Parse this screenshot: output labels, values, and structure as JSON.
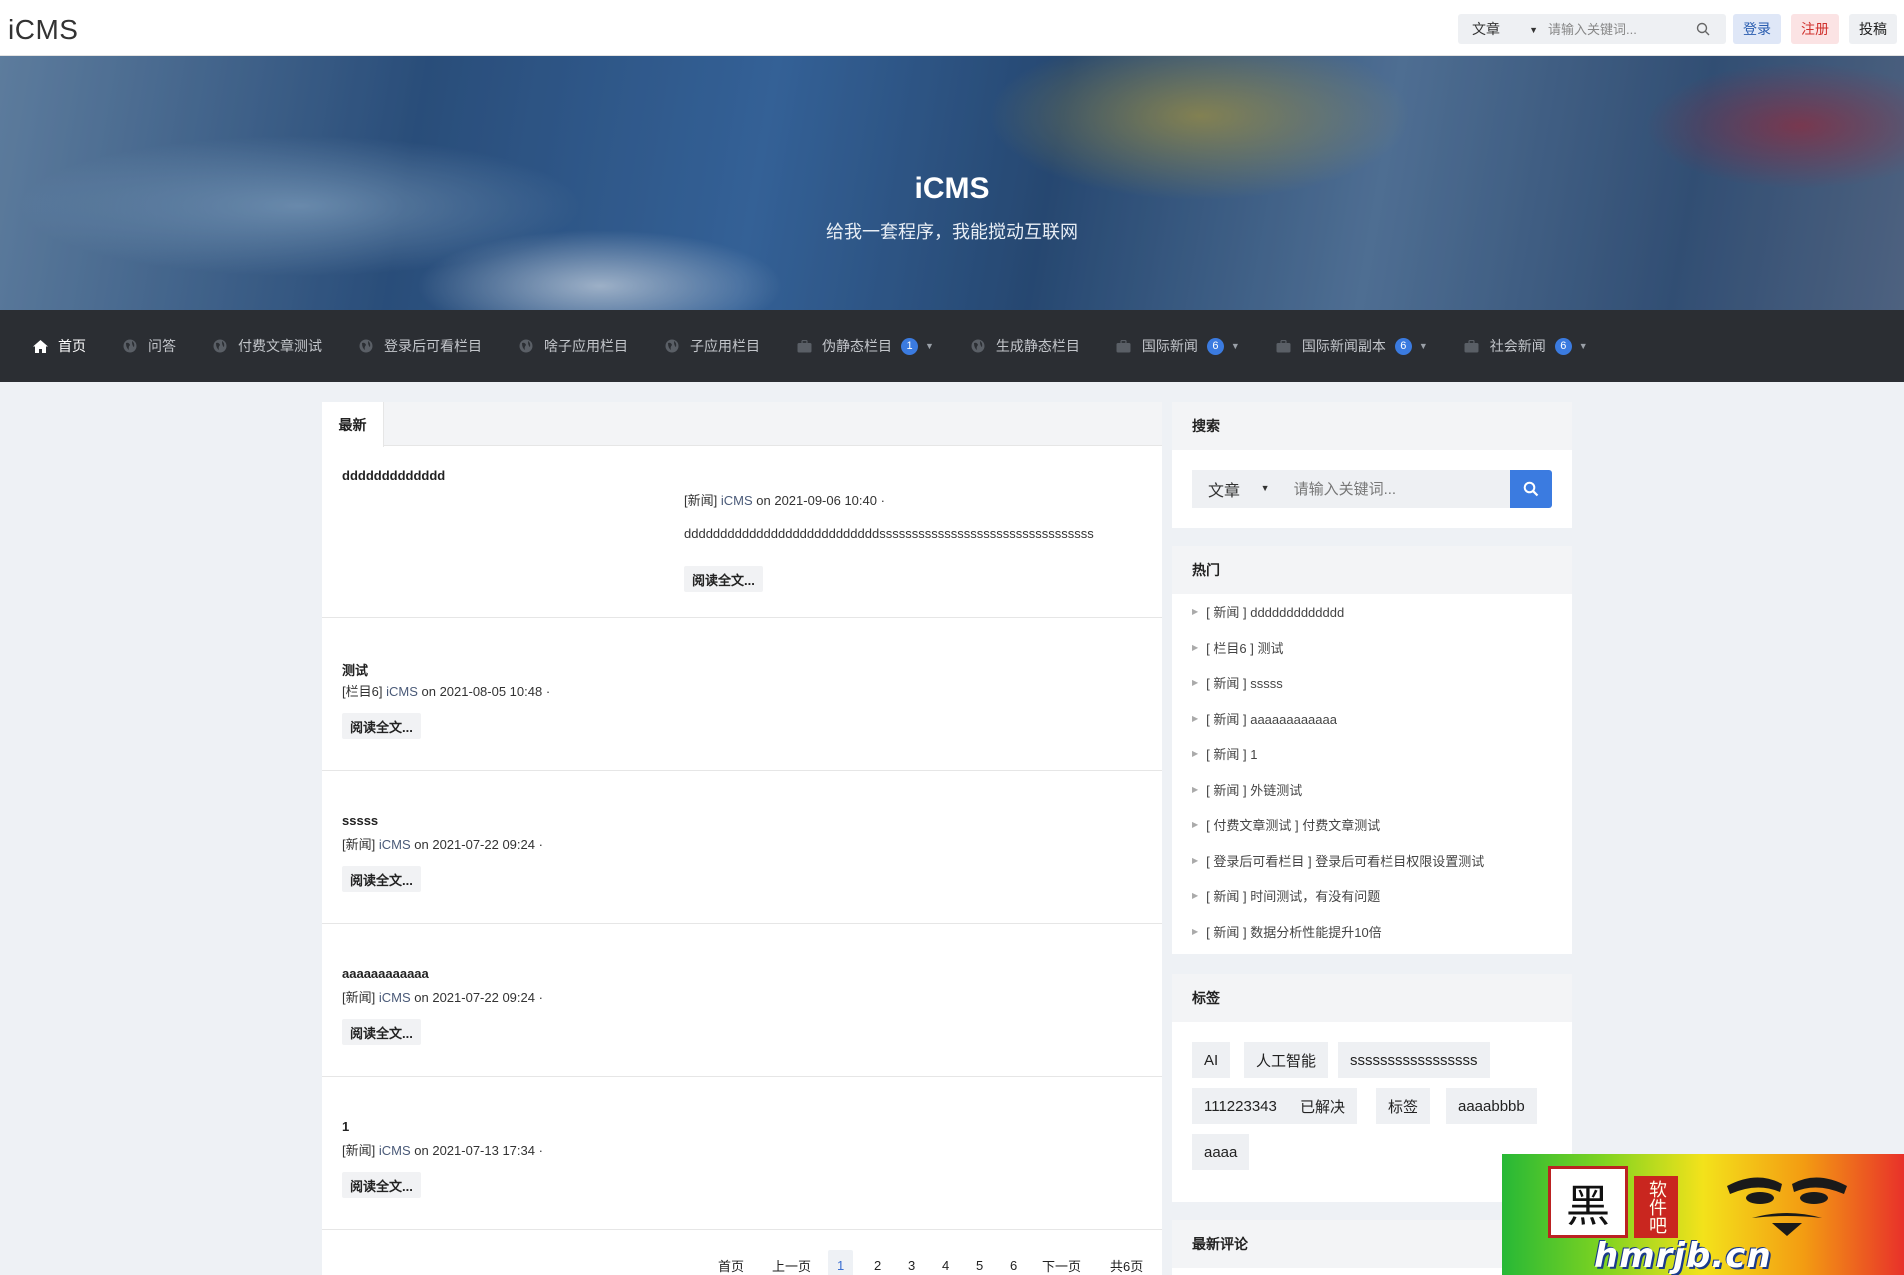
{
  "header": {
    "logo": "iCMS",
    "search_type": "文章",
    "search_placeholder": "请输入关键词...",
    "login": "登录",
    "register": "注册",
    "submit": "投稿"
  },
  "banner": {
    "title": "iCMS",
    "subtitle": "给我一套程序，我能搅动互联网"
  },
  "nav": {
    "items": [
      {
        "label": "首页",
        "icon": "home-icon",
        "badge": "",
        "dropdown": false
      },
      {
        "label": "问答",
        "icon": "globe-icon",
        "badge": "",
        "dropdown": false
      },
      {
        "label": "付费文章测试",
        "icon": "globe-icon",
        "badge": "",
        "dropdown": false
      },
      {
        "label": "登录后可看栏目",
        "icon": "globe-icon",
        "badge": "",
        "dropdown": false
      },
      {
        "label": "啥子应用栏目",
        "icon": "globe-icon",
        "badge": "",
        "dropdown": false
      },
      {
        "label": "子应用栏目",
        "icon": "globe-icon",
        "badge": "",
        "dropdown": false
      },
      {
        "label": "伪静态栏目",
        "icon": "briefcase-icon",
        "badge": "1",
        "dropdown": true
      },
      {
        "label": "生成静态栏目",
        "icon": "globe-icon",
        "badge": "",
        "dropdown": false
      },
      {
        "label": "国际新闻",
        "icon": "briefcase-icon",
        "badge": "6",
        "dropdown": true
      },
      {
        "label": "国际新闻副本",
        "icon": "briefcase-icon",
        "badge": "6",
        "dropdown": true
      },
      {
        "label": "社会新闻",
        "icon": "briefcase-icon",
        "badge": "6",
        "dropdown": true
      }
    ]
  },
  "main": {
    "tab": "最新",
    "read_more": "阅读全文...",
    "articles": [
      {
        "title": "ddddddddddddd",
        "category": "[新闻]",
        "author": "iCMS",
        "date": "on 2021-09-06 10:40 ·",
        "excerpt": "dddddddddddddddddddddddddddsssssssssssssssssssssssssssssssss"
      },
      {
        "title": "测试",
        "category": "[栏目6]",
        "author": "iCMS",
        "date": "on 2021-08-05 10:48 ·",
        "excerpt": ""
      },
      {
        "title": "sssss",
        "category": "[新闻]",
        "author": "iCMS",
        "date": "on 2021-07-22 09:24 ·",
        "excerpt": ""
      },
      {
        "title": "aaaaaaaaaaaa",
        "category": "[新闻]",
        "author": "iCMS",
        "date": "on 2021-07-22 09:24 ·",
        "excerpt": ""
      },
      {
        "title": "1",
        "category": "[新闻]",
        "author": "iCMS",
        "date": "on 2021-07-13 17:34 ·",
        "excerpt": ""
      }
    ],
    "pager": {
      "first": "首页",
      "prev": "上一页",
      "pages": [
        "1",
        "2",
        "3",
        "4",
        "5",
        "6"
      ],
      "current": "1",
      "next": "下一页",
      "total": "共6页"
    }
  },
  "sidebar": {
    "search_title": "搜索",
    "search_type": "文章",
    "search_placeholder": "请输入关键词...",
    "hot_title": "热门",
    "hot": [
      "[ 新闻 ] ddddddddddddd",
      "[ 栏目6 ] 测试",
      "[ 新闻 ] sssss",
      "[ 新闻 ] aaaaaaaaaaaa",
      "[ 新闻 ] 1",
      "[ 新闻 ] 外链测试",
      "[ 付费文章测试 ] 付费文章测试",
      "[ 登录后可看栏目 ] 登录后可看栏目权限设置测试",
      "[ 新闻 ] 时间测试，有没有问题",
      "[ 新闻 ] 数据分析性能提升10倍"
    ],
    "tags_title": "标签",
    "tags": [
      "AI",
      "人工智能",
      "sssssssssssssssss",
      "111223343",
      "已解决",
      "标签",
      "aaaabbbb",
      "aaaa"
    ],
    "comments_title": "最新评论"
  },
  "watermark": {
    "seal": "黑",
    "seal_side": "软件吧",
    "url": "hmrjb.cn"
  },
  "colors": {
    "accent": "#3b7be0",
    "nav_bg": "#2b2e33",
    "page_bg": "#eef1f5"
  }
}
